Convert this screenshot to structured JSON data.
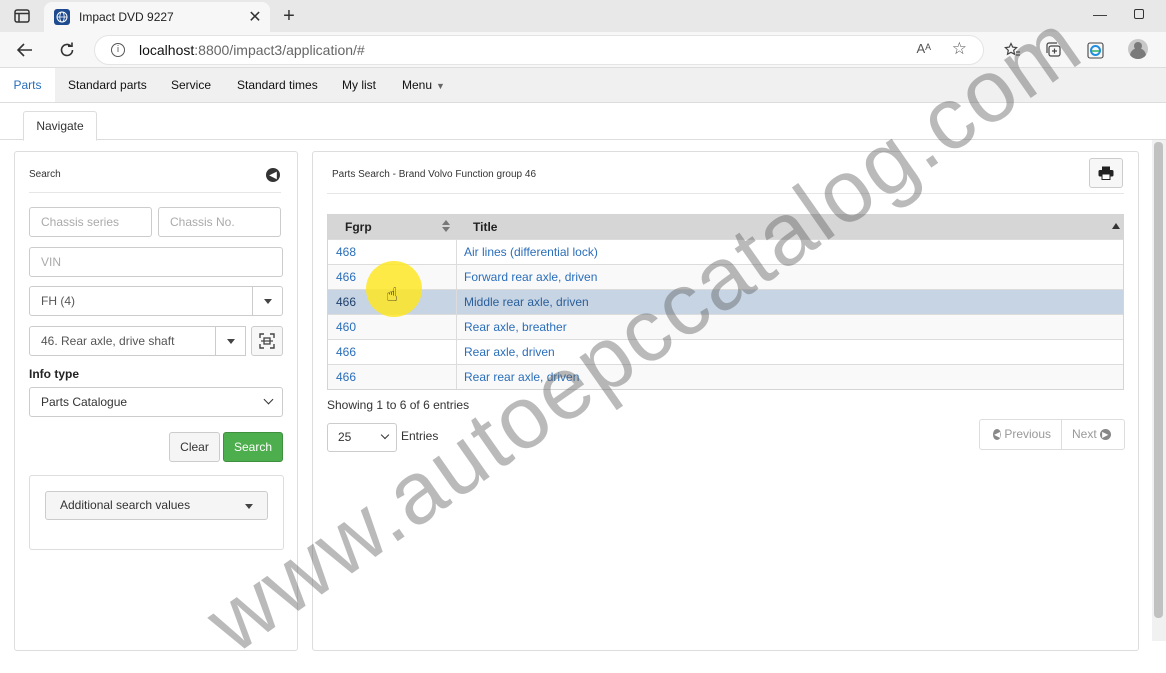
{
  "browser": {
    "tab_title": "Impact DVD 9227",
    "url_host": "localhost",
    "url_rest": ":8800/impact3/application/#",
    "read_aloud_glyph": "Aᴬ"
  },
  "appnav": {
    "items": [
      "Parts",
      "Standard parts",
      "Service",
      "Standard times",
      "My list",
      "Menu"
    ]
  },
  "subtabs": {
    "navigate": "Navigate"
  },
  "search_panel": {
    "title": "Search",
    "chassis_series_placeholder": "Chassis series",
    "chassis_no_placeholder": "Chassis No.",
    "vin_placeholder": "VIN",
    "model_value": "FH (4)",
    "function_group_value": "46. Rear axle, drive shaft",
    "info_type_label": "Info type",
    "info_type_value": "Parts Catalogue",
    "clear_label": "Clear",
    "search_label": "Search",
    "additional_label": "Additional search values"
  },
  "results_panel": {
    "breadcrumb": "Parts Search - Brand Volvo Function group 46",
    "columns": [
      "Fgrp",
      "Title"
    ],
    "rows": [
      {
        "fgrp": "468",
        "title": "Air lines (differential lock)"
      },
      {
        "fgrp": "466",
        "title": "Forward rear axle, driven"
      },
      {
        "fgrp": "466",
        "title": "Middle rear axle, driven"
      },
      {
        "fgrp": "460",
        "title": "Rear axle, breather"
      },
      {
        "fgrp": "466",
        "title": "Rear axle, driven"
      },
      {
        "fgrp": "466",
        "title": "Rear rear axle, driven"
      }
    ],
    "selected_row_index": 2,
    "showing_text": "Showing 1 to 6 of 6 entries",
    "page_size": "25",
    "entries_label": "Entries",
    "previous_label": "Previous",
    "next_label": "Next"
  },
  "watermark": "www.autoepccatalog.com",
  "colors": {
    "link_blue": "#2a6ebb",
    "selected_row": "#c6d4e4",
    "search_green": "#4cae4c",
    "highlight_yellow": "#ffe61e"
  }
}
